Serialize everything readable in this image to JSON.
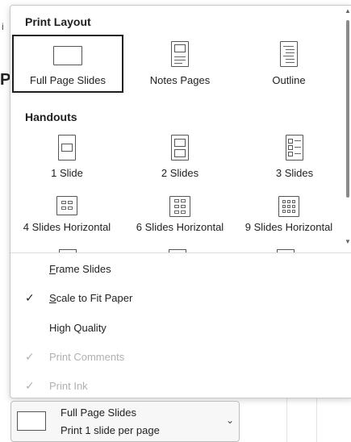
{
  "background": {
    "letter_i": "i",
    "letter_p": "P"
  },
  "popup": {
    "print_layout": {
      "title": "Print Layout",
      "options": [
        {
          "label": "Full Page Slides",
          "icon": "full-page-slide-icon",
          "selected": true
        },
        {
          "label": "Notes Pages",
          "icon": "notes-page-icon",
          "selected": false
        },
        {
          "label": "Outline",
          "icon": "outline-icon",
          "selected": false
        }
      ]
    },
    "handouts": {
      "title": "Handouts",
      "options": [
        {
          "label": "1 Slide",
          "icon": "handout-1-slide-icon"
        },
        {
          "label": "2 Slides",
          "icon": "handout-2-slides-icon"
        },
        {
          "label": "3 Slides",
          "icon": "handout-3-slides-icon"
        },
        {
          "label": "4 Slides Horizontal",
          "icon": "handout-4-horizontal-icon"
        },
        {
          "label": "6 Slides Horizontal",
          "icon": "handout-6-horizontal-icon"
        },
        {
          "label": "9 Slides Horizontal",
          "icon": "handout-9-horizontal-icon"
        }
      ]
    },
    "menu": [
      {
        "accel": "F",
        "rest": "rame Slides",
        "checked": false,
        "enabled": true
      },
      {
        "accel": "S",
        "rest": "cale to Fit Paper",
        "checked": true,
        "enabled": true
      },
      {
        "accel": "",
        "rest": "High Quality",
        "checked": false,
        "enabled": true
      },
      {
        "accel": "",
        "rest": "Print Comments",
        "checked": true,
        "enabled": false
      },
      {
        "accel": "",
        "rest": "Print Ink",
        "checked": true,
        "enabled": false
      }
    ],
    "check_glyph": "✓"
  },
  "dropdown": {
    "line1": "Full Page Slides",
    "line2": "Print 1 slide per page",
    "chevron": "⌄"
  }
}
